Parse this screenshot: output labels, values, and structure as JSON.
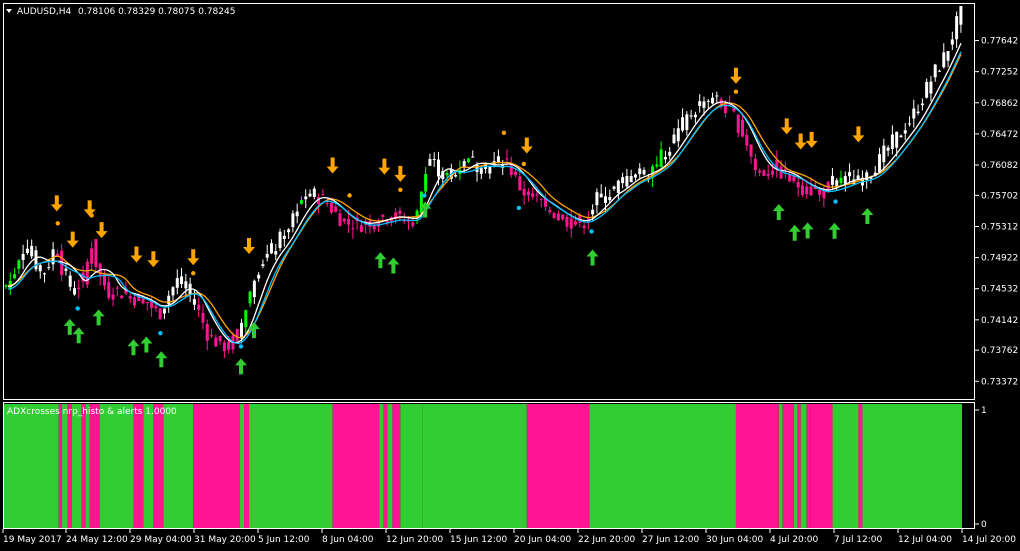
{
  "window": {
    "symbol_label": "AUDUSD,H4",
    "ohlc_label": "0.78106 0.78329 0.78075 0.78245",
    "menu_icon": "triangle-down-icon"
  },
  "indicator": {
    "label": "ADXcrosses nrp_histo & alerts 1.0000",
    "scale_top": "1",
    "scale_bottom": "0"
  },
  "colors": {
    "background": "#000000",
    "frame": "#ffffff",
    "bull_candle": "#ffffff",
    "bear_candle": "#ff1493",
    "mixed_candle": "#00ff00",
    "ma_fast": "#00bfff",
    "ma_mid": "#ffffff",
    "ma_slow": "#ffa500",
    "arrow_up": "#32cd32",
    "arrow_down": "#ffa500",
    "histo_up": "#32cd32",
    "histo_down": "#ff1493"
  },
  "chart_data": {
    "type": "candlestick",
    "symbol": "AUDUSD",
    "timeframe": "H4",
    "y_ticks": [
      "0.77642",
      "0.77252",
      "0.76862",
      "0.76472",
      "0.76082",
      "0.75702",
      "0.75312",
      "0.74922",
      "0.74532",
      "0.74142",
      "0.73762",
      "0.73372"
    ],
    "ylim": [
      0.7315,
      0.781
    ],
    "x_ticks": [
      "19 May 2017",
      "24 May 12:00",
      "29 May 04:00",
      "31 May 20:00",
      "5 Jun 12:00",
      "8 Jun 04:00",
      "12 Jun 20:00",
      "15 Jun 12:00",
      "20 Jun 04:00",
      "22 Jun 20:00",
      "27 Jun 12:00",
      "30 Jun 04:00",
      "4 Jul 20:00",
      "7 Jul 12:00",
      "12 Jul 04:00",
      "14 Jul 20:00"
    ],
    "price_path": [
      [
        0,
        0.7455
      ],
      [
        8,
        0.7465
      ],
      [
        15,
        0.7495
      ],
      [
        22,
        0.751
      ],
      [
        30,
        0.749
      ],
      [
        38,
        0.747
      ],
      [
        45,
        0.7485
      ],
      [
        52,
        0.751
      ],
      [
        60,
        0.747
      ],
      [
        70,
        0.745
      ],
      [
        80,
        0.7465
      ],
      [
        88,
        0.751
      ],
      [
        95,
        0.747
      ],
      [
        105,
        0.745
      ],
      [
        115,
        0.745
      ],
      [
        125,
        0.7445
      ],
      [
        135,
        0.744
      ],
      [
        145,
        0.7435
      ],
      [
        155,
        0.742
      ],
      [
        165,
        0.7445
      ],
      [
        175,
        0.7465
      ],
      [
        185,
        0.745
      ],
      [
        195,
        0.7425
      ],
      [
        205,
        0.7395
      ],
      [
        215,
        0.7385
      ],
      [
        225,
        0.738
      ],
      [
        235,
        0.7395
      ],
      [
        245,
        0.744
      ],
      [
        255,
        0.748
      ],
      [
        265,
        0.7495
      ],
      [
        275,
        0.751
      ],
      [
        285,
        0.753
      ],
      [
        295,
        0.756
      ],
      [
        305,
        0.757
      ],
      [
        315,
        0.757
      ],
      [
        325,
        0.756
      ],
      [
        335,
        0.7545
      ],
      [
        345,
        0.7535
      ],
      [
        355,
        0.7535
      ],
      [
        365,
        0.7535
      ],
      [
        375,
        0.754
      ],
      [
        385,
        0.7545
      ],
      [
        395,
        0.7545
      ],
      [
        405,
        0.7535
      ],
      [
        415,
        0.7545
      ],
      [
        425,
        0.762
      ],
      [
        435,
        0.7605
      ],
      [
        445,
        0.759
      ],
      [
        455,
        0.7605
      ],
      [
        465,
        0.7615
      ],
      [
        475,
        0.761
      ],
      [
        485,
        0.7605
      ],
      [
        495,
        0.761
      ],
      [
        505,
        0.7615
      ],
      [
        515,
        0.7585
      ],
      [
        525,
        0.757
      ],
      [
        535,
        0.7565
      ],
      [
        545,
        0.7555
      ],
      [
        555,
        0.7545
      ],
      [
        565,
        0.754
      ],
      [
        575,
        0.7535
      ],
      [
        585,
        0.754
      ],
      [
        595,
        0.7565
      ],
      [
        605,
        0.757
      ],
      [
        615,
        0.758
      ],
      [
        625,
        0.759
      ],
      [
        635,
        0.76
      ],
      [
        645,
        0.7595
      ],
      [
        655,
        0.761
      ],
      [
        665,
        0.7625
      ],
      [
        675,
        0.7645
      ],
      [
        685,
        0.7665
      ],
      [
        695,
        0.768
      ],
      [
        705,
        0.769
      ],
      [
        715,
        0.769
      ],
      [
        725,
        0.768
      ],
      [
        735,
        0.7665
      ],
      [
        745,
        0.764
      ],
      [
        755,
        0.76
      ],
      [
        765,
        0.76
      ],
      [
        775,
        0.7605
      ],
      [
        785,
        0.7595
      ],
      [
        795,
        0.7585
      ],
      [
        805,
        0.758
      ],
      [
        815,
        0.7575
      ],
      [
        825,
        0.7575
      ],
      [
        835,
        0.759
      ],
      [
        845,
        0.759
      ],
      [
        855,
        0.759
      ],
      [
        865,
        0.7595
      ],
      [
        875,
        0.7605
      ],
      [
        885,
        0.7625
      ],
      [
        895,
        0.764
      ],
      [
        905,
        0.7655
      ],
      [
        915,
        0.7675
      ],
      [
        925,
        0.77
      ],
      [
        935,
        0.7725
      ],
      [
        945,
        0.7745
      ],
      [
        955,
        0.778
      ],
      [
        962,
        0.78
      ]
    ],
    "bear_ranges": [
      [
        52,
        62
      ],
      [
        75,
        100
      ],
      [
        100,
        160
      ],
      [
        195,
        235
      ],
      [
        312,
        340
      ],
      [
        340,
        412
      ],
      [
        505,
        590
      ],
      [
        720,
        760
      ],
      [
        760,
        830
      ]
    ],
    "mixed_ranges": [
      [
        0,
        15
      ],
      [
        240,
        255
      ],
      [
        280,
        300
      ],
      [
        410,
        425
      ],
      [
        440,
        470
      ],
      [
        540,
        560
      ],
      [
        650,
        670
      ],
      [
        830,
        850
      ]
    ],
    "down_arrows": [
      53,
      69,
      86,
      98,
      133,
      150,
      190,
      246,
      330,
      382,
      398,
      525,
      735,
      786,
      800,
      811,
      858
    ],
    "up_arrows": [
      66,
      75,
      95,
      130,
      143,
      158,
      238,
      251,
      378,
      391,
      423,
      591,
      778,
      794,
      807,
      834,
      867
    ],
    "signal_dots_up": [
      54,
      88,
      190,
      347,
      398,
      502,
      522,
      735
    ],
    "signal_dots_down": [
      74,
      157,
      238,
      422,
      517,
      590,
      835
    ],
    "histogram_segments": [
      [
        0,
        55,
        "up"
      ],
      [
        55,
        58,
        "down"
      ],
      [
        58,
        64,
        "up"
      ],
      [
        64,
        68,
        "down"
      ],
      [
        68,
        78,
        "up"
      ],
      [
        78,
        82,
        "down"
      ],
      [
        82,
        86,
        "up"
      ],
      [
        86,
        96,
        "down"
      ],
      [
        96,
        130,
        "up"
      ],
      [
        130,
        140,
        "down"
      ],
      [
        140,
        150,
        "up"
      ],
      [
        150,
        160,
        "down"
      ],
      [
        160,
        190,
        "up"
      ],
      [
        190,
        237,
        "down"
      ],
      [
        237,
        241,
        "up"
      ],
      [
        241,
        246,
        "down"
      ],
      [
        246,
        330,
        "up"
      ],
      [
        330,
        377,
        "down"
      ],
      [
        377,
        381,
        "up"
      ],
      [
        381,
        385,
        "down"
      ],
      [
        385,
        390,
        "up"
      ],
      [
        390,
        398,
        "down"
      ],
      [
        398,
        420,
        "up"
      ],
      [
        420,
        525,
        "up"
      ],
      [
        525,
        588,
        "down"
      ],
      [
        588,
        735,
        "up"
      ],
      [
        735,
        778,
        "down"
      ],
      [
        778,
        782,
        "up"
      ],
      [
        782,
        793,
        "down"
      ],
      [
        793,
        797,
        "up"
      ],
      [
        797,
        800,
        "down"
      ],
      [
        800,
        806,
        "up"
      ],
      [
        806,
        810,
        "down"
      ],
      [
        810,
        832,
        "down"
      ],
      [
        832,
        858,
        "up"
      ],
      [
        858,
        862,
        "down"
      ],
      [
        862,
        962,
        "up"
      ]
    ]
  }
}
